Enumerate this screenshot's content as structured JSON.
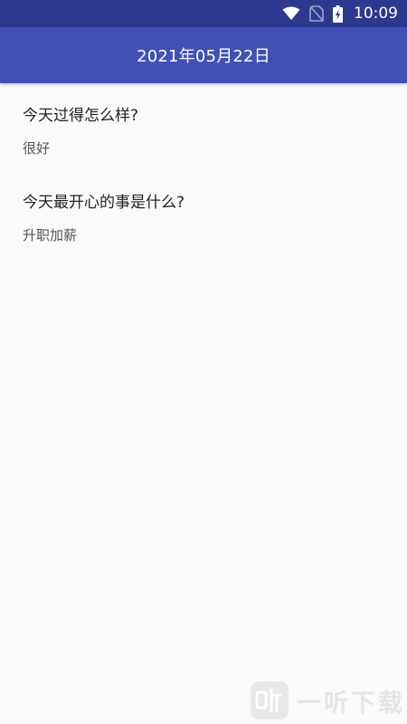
{
  "status_bar": {
    "time": "10:09",
    "icons": [
      "wifi-icon",
      "no-sim-icon",
      "battery-charging-icon"
    ]
  },
  "app_bar": {
    "title": "2021年05月22日"
  },
  "entries": [
    {
      "question": "今天过得怎么样?",
      "answer": "很好"
    },
    {
      "question": "今天最开心的事是什么?",
      "answer": "升职加薪"
    }
  ],
  "watermark": {
    "text": "一听下载"
  },
  "colors": {
    "status_bar": "#2b3a8f",
    "app_bar": "#3f51b5",
    "background": "#fafafa"
  }
}
